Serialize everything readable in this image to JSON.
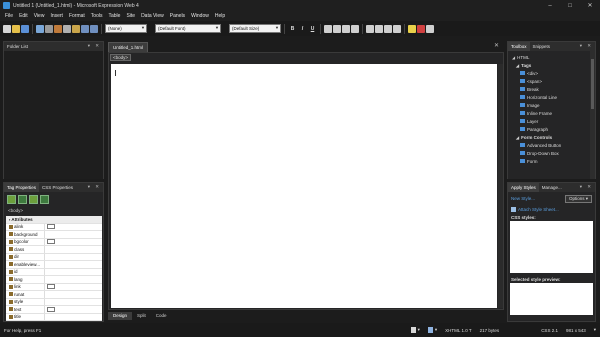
{
  "window": {
    "title": "Untitled 1 (Untitled_1.html) - Microsoft Expression Web 4",
    "controls": [
      "–",
      "□",
      "✕"
    ]
  },
  "menubar": [
    "File",
    "Edit",
    "View",
    "Insert",
    "Format",
    "Tools",
    "Table",
    "Site",
    "Data View",
    "Panels",
    "Window",
    "Help"
  ],
  "toolbar": {
    "style_select": "(None)",
    "font_select": "(Default Font)",
    "size_select": "(Default Size)",
    "format_buttons": [
      "B",
      "I",
      "U"
    ]
  },
  "folder_list": {
    "title": "Folder List"
  },
  "tag_properties": {
    "tabs": [
      "Tag Properties",
      "CSS Properties"
    ],
    "breadcrumb": "<body>",
    "header": "Attributes",
    "attributes": [
      "alink",
      "background",
      "bgcolor",
      "class",
      "dir",
      "enableview...",
      "id",
      "lang",
      "link",
      "runat",
      "style",
      "text",
      "title"
    ]
  },
  "editor": {
    "tab_label": "Untitled_1.html",
    "breadcrumb": "<body>",
    "view_tabs": [
      "Design",
      "Split",
      "Code"
    ]
  },
  "toolbox": {
    "tabs": [
      "Toolbox",
      "Snippets"
    ],
    "items": [
      {
        "label": "HTML",
        "kind": "section"
      },
      {
        "label": "Tags",
        "kind": "group"
      },
      {
        "label": "<div>",
        "kind": "item"
      },
      {
        "label": "<span>",
        "kind": "item"
      },
      {
        "label": "Break",
        "kind": "item"
      },
      {
        "label": "Horizontal Line",
        "kind": "item"
      },
      {
        "label": "Image",
        "kind": "item"
      },
      {
        "label": "Inline Frame",
        "kind": "item"
      },
      {
        "label": "Layer",
        "kind": "item"
      },
      {
        "label": "Paragraph",
        "kind": "item"
      },
      {
        "label": "Form Controls",
        "kind": "group"
      },
      {
        "label": "Advanced Button",
        "kind": "item"
      },
      {
        "label": "Drop-Down Box",
        "kind": "item"
      },
      {
        "label": "Form",
        "kind": "item"
      }
    ]
  },
  "apply_styles": {
    "tabs": [
      "Apply Styles",
      "Manage..."
    ],
    "new_style": "New Style...",
    "options": "Options",
    "attach": "Attach Style Sheet...",
    "css_styles_label": "CSS styles:",
    "preview_label": "Selected style preview:"
  },
  "statusbar": {
    "help": "For Help, press F1",
    "doctype": "XHTML 1.0 T",
    "size": "217 bytes",
    "css": "CSS 2.1",
    "dimensions": "981 x 543"
  },
  "colors": {
    "accent": "#3a8fd8",
    "panel_bg": "#252526",
    "page_bg": "#ffffff"
  }
}
